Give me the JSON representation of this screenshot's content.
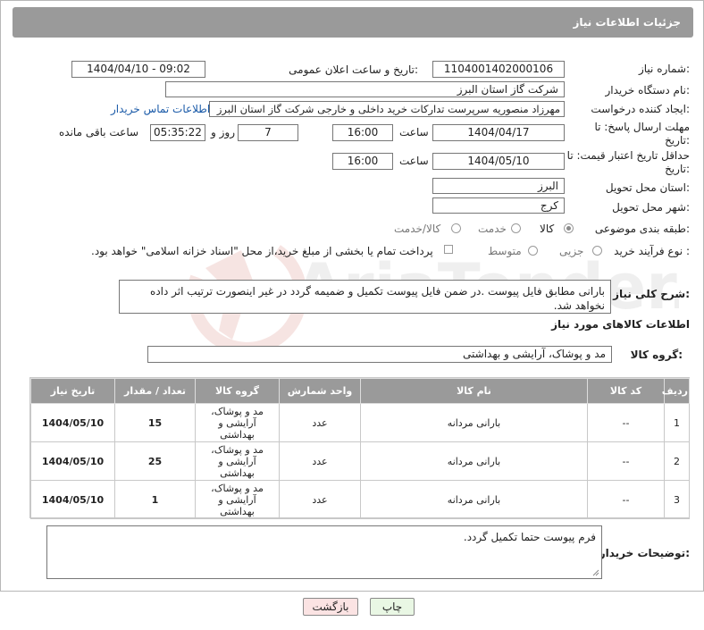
{
  "header": {
    "title": "جزئیات اطلاعات نیاز"
  },
  "fields": {
    "need_number_label": "شماره نیاز:",
    "need_number": "1104001402000106",
    "announce_label": "تاریخ و ساعت اعلان عمومی:",
    "announce_value": "1404/04/10 - 09:02",
    "buyer_org_label": "نام دستگاه خریدار:",
    "buyer_org": "شرکت گاز استان البرز",
    "creator_label": "ایجاد کننده درخواست:",
    "creator": "مهرزاد منصوریه سرپرست تدارکات خرید داخلی و خارجی شرکت گاز استان البرز",
    "contact_link": "اطلاعات تماس خریدار",
    "deadline_label": "مهلت ارسال پاسخ: تا تاریخ:",
    "deadline_date": "1404/04/17",
    "time_label": "ساعت",
    "deadline_time": "16:00",
    "days_value": "7",
    "days_label": "روز و",
    "remaining_time": "05:35:22",
    "remaining_label": "ساعت باقی مانده",
    "validity_label": "حداقل تاریخ اعتبار قیمت: تا تاریخ:",
    "validity_date": "1404/05/10",
    "validity_time": "16:00",
    "province_label": "استان محل تحویل:",
    "province": "البرز",
    "city_label": "شهر محل تحویل:",
    "city": "کرج",
    "category_label": "طبقه بندی موضوعی:",
    "category_options": [
      "کالا",
      "خدمت",
      "کالا/خدمت"
    ],
    "process_label": "نوع فرآیند خرید :",
    "process_options": [
      "جزیی",
      "متوسط"
    ],
    "payment_note": "پرداخت تمام یا بخشی از مبلغ خرید،از محل \"اسناد خزانه اسلامی\" خواهد بود."
  },
  "description": {
    "label": "شرح کلی نیاز:",
    "text": "بارانی مطابق فایل پیوست .در ضمن فایل پیوست تکمیل و ضمیمه گردد در غیر اینصورت ترتیب اثر داده نخواهد شد."
  },
  "goods": {
    "section_title": "اطلاعات کالاهای مورد نیاز",
    "group_label": "گروه کالا:",
    "group_value": "مد و پوشاک، آرایشی و بهداشتی",
    "columns": [
      "ردیف",
      "کد کالا",
      "نام کالا",
      "واحد شمارش",
      "گروه کالا",
      "تعداد / مقدار",
      "تاریخ نیاز"
    ],
    "rows": [
      {
        "idx": "1",
        "code": "--",
        "name": "بارانی مردانه",
        "unit": "عدد",
        "group": "مد و پوشاک، آرایشی و بهداشتی",
        "qty": "15",
        "date": "1404/05/10"
      },
      {
        "idx": "2",
        "code": "--",
        "name": "بارانی مردانه",
        "unit": "عدد",
        "group": "مد و پوشاک، آرایشی و بهداشتی",
        "qty": "25",
        "date": "1404/05/10"
      },
      {
        "idx": "3",
        "code": "--",
        "name": "بارانی مردانه",
        "unit": "عدد",
        "group": "مد و پوشاک، آرایشی و بهداشتی",
        "qty": "1",
        "date": "1404/05/10"
      }
    ]
  },
  "buyer_notes": {
    "label": "توضیحات خریدار:",
    "text": "فرم پیوست حتما تکمیل گردد."
  },
  "buttons": {
    "print": "چاپ",
    "back": "بازگشت"
  },
  "watermark_text": "AriaTender.neT",
  "colors": {
    "header_bg": "#9a9a9a",
    "link": "#1a5aa8",
    "print_bg": "#e9f7e4",
    "back_bg": "#fbe3e3"
  }
}
